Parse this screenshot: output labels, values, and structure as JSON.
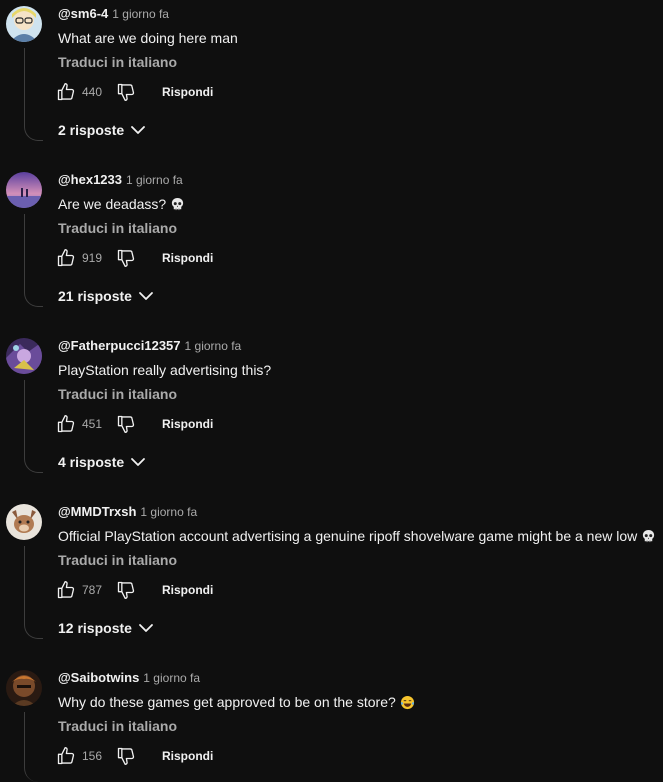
{
  "ui": {
    "translate_label": "Traduci in italiano",
    "reply_label": "Rispondi"
  },
  "comments": [
    {
      "handle": "@sm6-4",
      "time": "1 giorno fa",
      "text": "What are we doing here man",
      "emoji": "",
      "likes": "440",
      "replies": "2 risposte"
    },
    {
      "handle": "@hex1233",
      "time": "1 giorno fa",
      "text": "Are we deadass?",
      "emoji": "skull",
      "likes": "919",
      "replies": "21 risposte"
    },
    {
      "handle": "@Fatherpucci12357",
      "time": "1 giorno fa",
      "text": "PlayStation really advertising this?",
      "emoji": "",
      "likes": "451",
      "replies": "4 risposte"
    },
    {
      "handle": "@MMDTrxsh",
      "time": "1 giorno fa",
      "text": "Official PlayStation account advertising a genuine ripoff shovelware game might be a new low",
      "emoji": "skull",
      "likes": "787",
      "replies": "12 risposte"
    },
    {
      "handle": "@Saibotwins",
      "time": "1 giorno fa",
      "text": "Why do these games get approved to be on the store?",
      "emoji": "joy",
      "likes": "156",
      "replies": ""
    }
  ],
  "icons": {
    "like": "thumbs-up-icon",
    "dislike": "thumbs-down-icon",
    "expand": "chevron-down-icon",
    "skull": "skull-emoji",
    "joy": "tears-of-joy-emoji"
  },
  "colors": {
    "background": "#0f0f0f",
    "text_primary": "#f1f1f1",
    "text_secondary": "#aaaaaa",
    "thread_line": "#3d3d3d"
  }
}
